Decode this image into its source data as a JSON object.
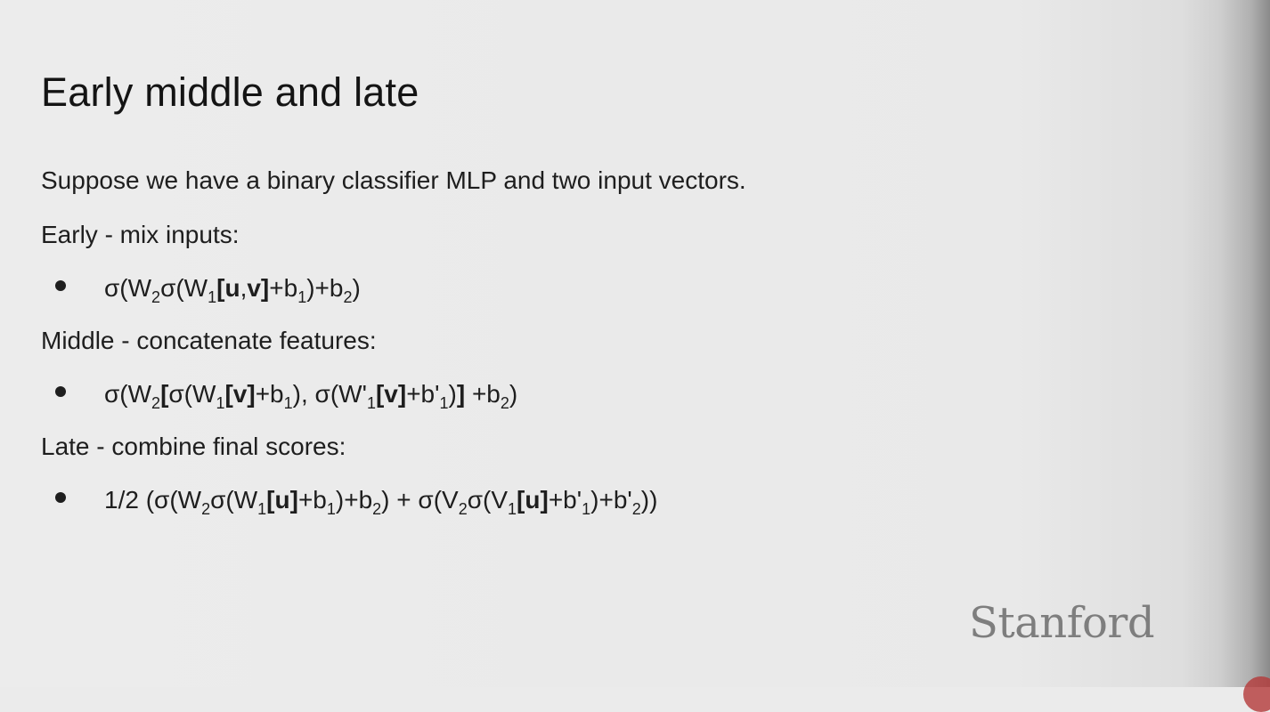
{
  "slide": {
    "title": "Early middle and late",
    "intro": "Suppose we have a binary classifier MLP and two input vectors.",
    "sections": [
      {
        "heading": "Early - mix inputs:",
        "formula": "σ(W₂σ(W₁[u,v]+b₁)+b₂)"
      },
      {
        "heading": "Middle - concatenate features:",
        "formula": "σ(W₂[σ(W₁[v]+b₁), σ(W'₁[v]+b'₁)] +b₂)"
      },
      {
        "heading": "Late - combine final scores:",
        "formula": "1/2 (σ(W₂σ(W₁[u]+b₁)+b₂) + σ(V₂σ(V₁[u]+b'₁)+b'₂))"
      }
    ]
  },
  "logo": {
    "text": "Stanford"
  }
}
